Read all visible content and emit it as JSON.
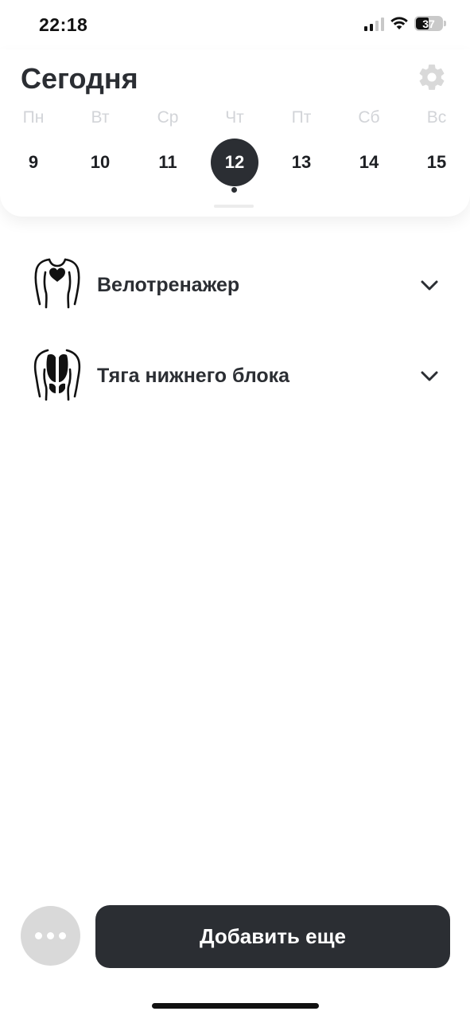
{
  "status_bar": {
    "time": "22:18",
    "battery": "37",
    "icons": [
      "signal-icon",
      "wifi-icon",
      "battery-icon"
    ]
  },
  "header": {
    "title": "Сегодня",
    "settings_icon": "gear-icon"
  },
  "week": {
    "weekdays": [
      "Пн",
      "Вт",
      "Ср",
      "Чт",
      "Пт",
      "Сб",
      "Вс"
    ],
    "days": [
      "9",
      "10",
      "11",
      "12",
      "13",
      "14",
      "15"
    ],
    "selected_index": 3
  },
  "exercises": [
    {
      "name": "Велотренажер",
      "icon": "cardio-heart-torso-icon",
      "chevron": "chevron-down-icon"
    },
    {
      "name": "Тяга нижнего блока",
      "icon": "back-muscles-torso-icon",
      "chevron": "chevron-down-icon"
    }
  ],
  "actions": {
    "more_icon": "more-dots-icon",
    "add_label": "Добавить еще"
  },
  "colors": {
    "primary_dark": "#2b2e33",
    "muted_text": "#d2d4d8",
    "more_button_bg": "#d9d9d9"
  }
}
